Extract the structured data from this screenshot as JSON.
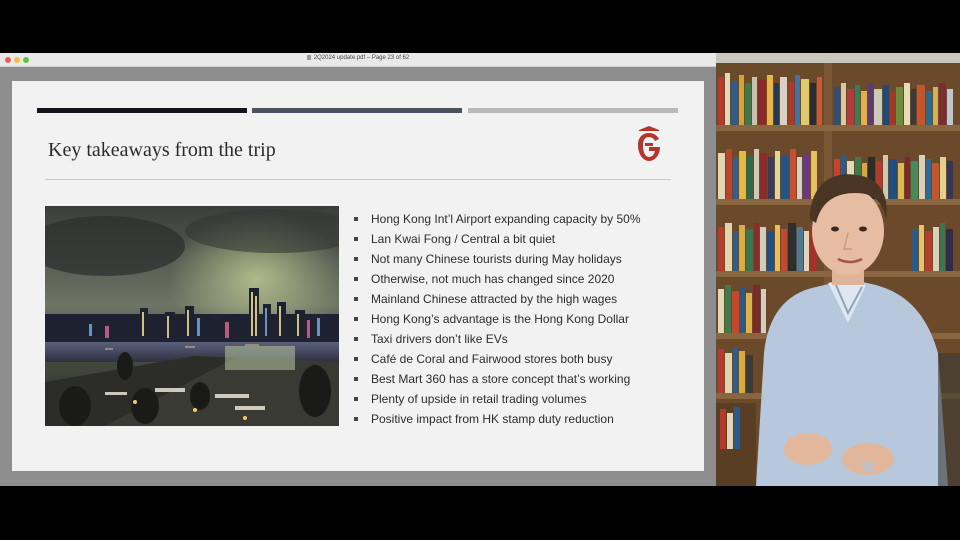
{
  "window": {
    "title": "2Q2024 update.pdf – Page 23 of 62"
  },
  "slide": {
    "title": "Key takeaways from the trip",
    "bullets": [
      "Hong Kong Int’l Airport expanding capacity by 50%",
      "Lan Kwai Fong / Central a bit quiet",
      "Not many Chinese tourists during May holidays",
      "Otherwise, not much has changed since 2020",
      "Mainland Chinese attracted by the high wages",
      "Hong Kong’s advantage is the Hong Kong Dollar",
      "Taxi drivers don’t like EVs",
      "Café de Coral and Fairwood stores both busy",
      "Best Mart 360 has a store concept that’s working",
      "Plenty of upside in retail trading volumes",
      "Positive impact from HK stamp duty reduction"
    ],
    "colors": {
      "logo_red": "#b5342c",
      "bar_dark": "#12151e",
      "bar_mid": "#4b5360",
      "bar_light": "#b9b9b9"
    }
  }
}
